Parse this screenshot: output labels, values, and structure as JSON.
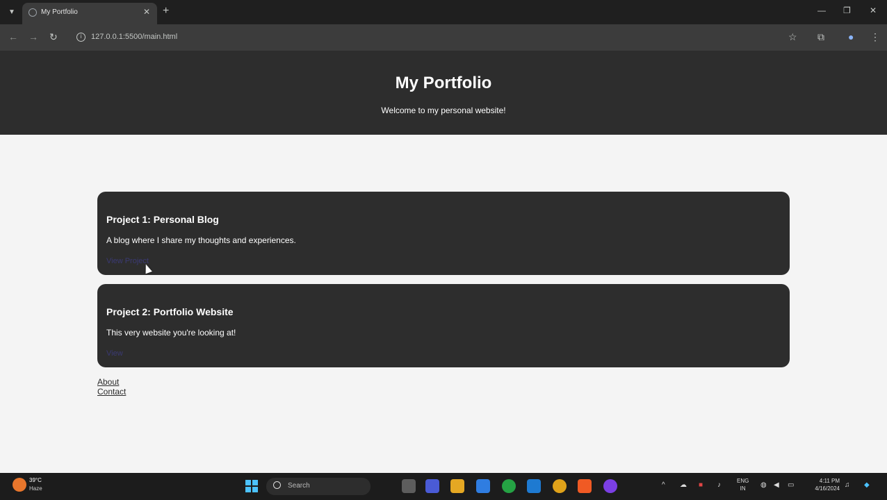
{
  "browser": {
    "tab_title": "My Portfolio",
    "url": "127.0.0.1:5500/main.html"
  },
  "page": {
    "header": {
      "title": "My Portfolio",
      "subtitle": "Welcome to my personal website!"
    },
    "projects": [
      {
        "title": "Project 1: Personal Blog",
        "description": "A blog where I share my thoughts and experiences.",
        "link": "View Project"
      },
      {
        "title": "Project 2: Portfolio Website",
        "description": "This very website you're looking at!",
        "link": "View"
      }
    ],
    "footer_links": [
      "About",
      "Contact"
    ]
  },
  "taskbar": {
    "weather_temp": "39°C",
    "weather_condition": "Haze",
    "search_placeholder": "Search",
    "lang_top": "ENG",
    "lang_bottom": "IN",
    "time": "4:11 PM",
    "date": "4/16/2024"
  },
  "colors": {
    "header_bg": "#2d2d2d",
    "page_bg": "#f4f4f4",
    "card_bg": "#2d2d2d",
    "link": "#3b3a74"
  }
}
